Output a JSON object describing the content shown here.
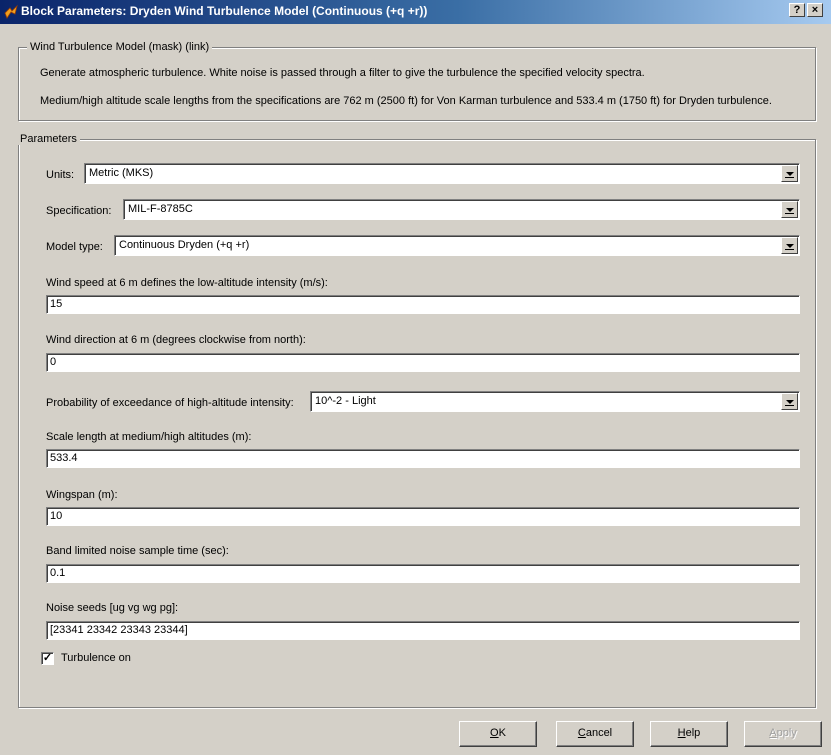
{
  "window": {
    "title": "Block Parameters: Dryden Wind Turbulence Model  (Continuous (+q +r))",
    "help_btn": "?",
    "close_btn": "×"
  },
  "description": {
    "legend": "Wind Turbulence Model (mask) (link)",
    "line1": "Generate atmospheric turbulence. White noise is passed through a filter to give the turbulence the specified velocity spectra.",
    "line2": "Medium/high altitude scale lengths from the specifications are 762 m (2500 ft) for Von Karman turbulence and 533.4 m (1750 ft) for Dryden turbulence."
  },
  "parameters": {
    "legend": "Parameters",
    "units": {
      "label": "Units:",
      "value": "Metric (MKS)"
    },
    "specification": {
      "label": "Specification:",
      "value": "MIL-F-8785C"
    },
    "model_type": {
      "label": "Model type:",
      "value": "Continuous Dryden (+q +r)"
    },
    "wind_speed": {
      "label": "Wind speed at 6 m defines the low-altitude intensity (m/s):",
      "value": "15"
    },
    "wind_direction": {
      "label": "Wind direction at 6 m (degrees clockwise from north):",
      "value": "0"
    },
    "probability": {
      "label": "Probability of exceedance of high-altitude intensity:",
      "value": "10^-2 - Light"
    },
    "scale_length": {
      "label": "Scale length at medium/high altitudes (m):",
      "value": "533.4"
    },
    "wingspan": {
      "label": "Wingspan (m):",
      "value": "10"
    },
    "sample_time": {
      "label": "Band limited noise sample time (sec):",
      "value": "0.1"
    },
    "noise_seeds": {
      "label": "Noise seeds [ug vg wg pg]:",
      "value": "[23341 23342 23343 23344]"
    },
    "turbulence_on": {
      "label": "Turbulence on",
      "checked": true,
      "mark": "✓"
    }
  },
  "buttons": {
    "ok_u": "O",
    "ok_rest": "K",
    "cancel_u": "C",
    "cancel_rest": "ancel",
    "help_u": "H",
    "help_rest": "elp",
    "apply_u": "A",
    "apply_rest": "pply"
  },
  "icons": {
    "title": "simulink-block-icon",
    "dropdown": "chevron-down-icon"
  }
}
